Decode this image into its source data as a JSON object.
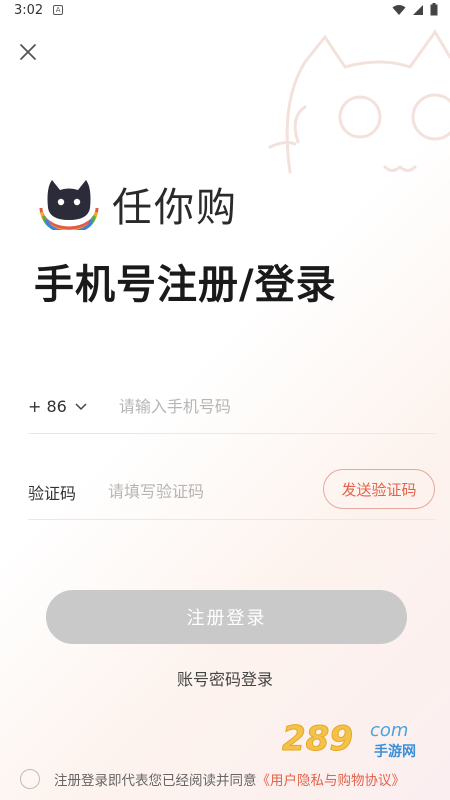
{
  "status_bar": {
    "time": "3:02",
    "notification_badge": "A",
    "icons": [
      "wifi-icon",
      "signal-icon",
      "battery-icon"
    ]
  },
  "header": {
    "close_icon": "close-icon"
  },
  "logo": {
    "text": "任你购",
    "icon": "cat-logo-icon"
  },
  "page": {
    "title": "手机号注册/登录"
  },
  "form": {
    "country_code": "+ 86",
    "phone_placeholder": "请输入手机号码",
    "phone_value": "",
    "code_label": "验证码",
    "code_placeholder": "请填写验证码",
    "code_value": "",
    "send_code_label": "发送验证码",
    "submit_label": "注册登录",
    "password_login_label": "账号密码登录"
  },
  "agreement": {
    "text": "注册登录即代表您已经阅读并同意",
    "link": "《用户隐私与购物协议》",
    "checked": false
  },
  "watermark": {
    "text_main": "289",
    "text_suffix": "com",
    "text_sub": "手游网"
  },
  "colors": {
    "accent": "#e4624a",
    "button_disabled": "#c9c9c9",
    "title": "#1a1a1a"
  }
}
